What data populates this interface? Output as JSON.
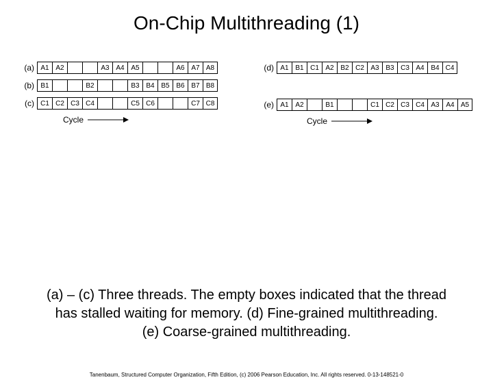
{
  "title": "On-Chip Multithreading (1)",
  "rows_left": [
    {
      "label": "(a)",
      "cells": [
        "A1",
        "A2",
        "",
        "",
        "A3",
        "A4",
        "A5",
        "",
        "",
        "A6",
        "A7",
        "A8"
      ]
    },
    {
      "label": "(b)",
      "cells": [
        "B1",
        "",
        "",
        "B2",
        "",
        "",
        "B3",
        "B4",
        "B5",
        "B6",
        "B7",
        "B8"
      ]
    },
    {
      "label": "(c)",
      "cells": [
        "C1",
        "C2",
        "C3",
        "C4",
        "",
        "",
        "C5",
        "C6",
        "",
        "",
        "C7",
        "C8"
      ]
    }
  ],
  "rows_right": [
    {
      "label": "(d)",
      "cells": [
        "A1",
        "B1",
        "C1",
        "A2",
        "B2",
        "C2",
        "A3",
        "B3",
        "C3",
        "A4",
        "B4",
        "C4"
      ]
    },
    {
      "label": "(e)",
      "cells": [
        "A1",
        "A2",
        "",
        "B1",
        "",
        "",
        "C1",
        "C2",
        "C3",
        "C4",
        "A3",
        "A4",
        "A5"
      ]
    }
  ],
  "cycle_label": "Cycle",
  "caption_lines": [
    "(a) – (c) Three threads. The empty boxes indicated that the thread",
    "has stalled waiting for memory.  (d) Fine-grained multithreading.",
    "(e) Coarse-grained multithreading."
  ],
  "footer": "Tanenbaum, Structured Computer Organization, Fifth Edition, (c) 2006 Pearson Education, Inc. All rights reserved. 0-13-148521-0"
}
